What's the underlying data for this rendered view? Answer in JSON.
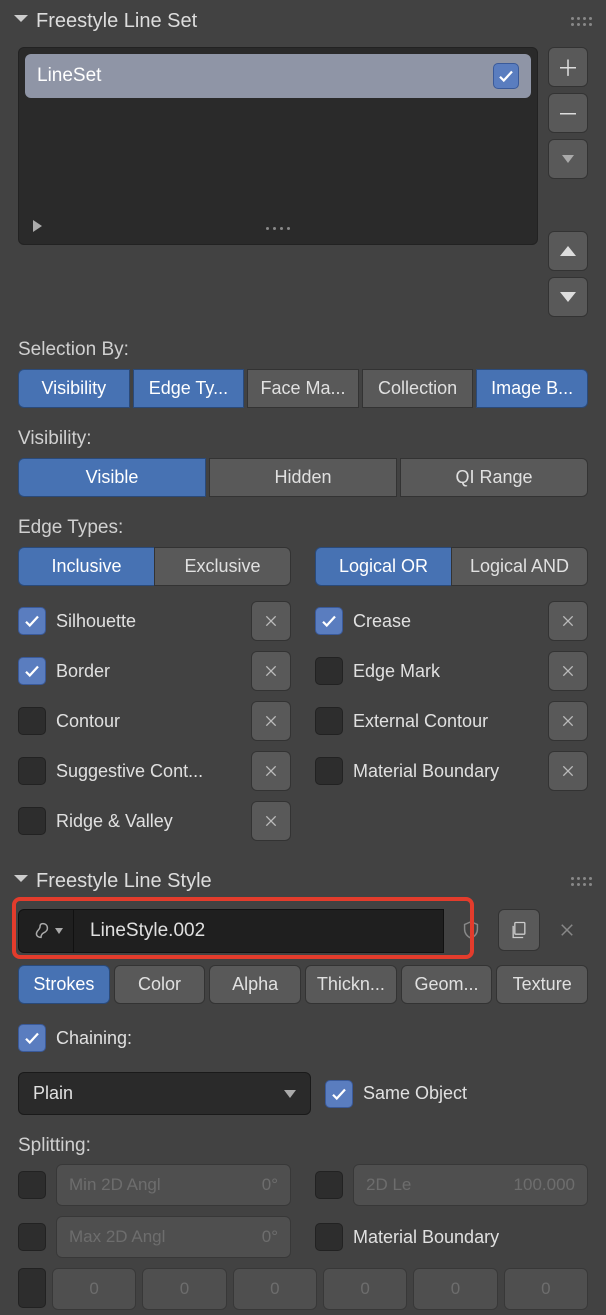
{
  "lineset_panel": {
    "title": "Freestyle Line Set",
    "items": [
      {
        "name": "LineSet",
        "enabled": true
      }
    ]
  },
  "selection_by": {
    "label": "Selection By:",
    "options": [
      {
        "label": "Visibility",
        "active": true
      },
      {
        "label": "Edge Ty...",
        "active": true
      },
      {
        "label": "Face Ma...",
        "active": false
      },
      {
        "label": "Collection",
        "active": false
      },
      {
        "label": "Image B...",
        "active": true
      }
    ]
  },
  "visibility": {
    "label": "Visibility:",
    "options": [
      {
        "label": "Visible",
        "active": true
      },
      {
        "label": "Hidden",
        "active": false
      },
      {
        "label": "QI Range",
        "active": false
      }
    ]
  },
  "edge_types": {
    "label": "Edge Types:",
    "inclusive": {
      "a": "Inclusive",
      "b": "Exclusive",
      "active": "a"
    },
    "logical": {
      "a": "Logical OR",
      "b": "Logical AND",
      "active": "a"
    },
    "checks": [
      {
        "left": {
          "label": "Silhouette",
          "on": true
        },
        "right": {
          "label": "Crease",
          "on": true
        }
      },
      {
        "left": {
          "label": "Border",
          "on": true
        },
        "right": {
          "label": "Edge Mark",
          "on": false
        }
      },
      {
        "left": {
          "label": "Contour",
          "on": false
        },
        "right": {
          "label": "External Contour",
          "on": false
        }
      },
      {
        "left": {
          "label": "Suggestive Cont...",
          "on": false
        },
        "right": {
          "label": "Material Boundary",
          "on": false
        }
      },
      {
        "left": {
          "label": "Ridge & Valley",
          "on": false
        },
        "right": null
      }
    ]
  },
  "linestyle_panel": {
    "title": "Freestyle Line Style",
    "name": "LineStyle.002",
    "tabs": [
      {
        "label": "Strokes",
        "active": true
      },
      {
        "label": "Color",
        "active": false
      },
      {
        "label": "Alpha",
        "active": false
      },
      {
        "label": "Thickn...",
        "active": false
      },
      {
        "label": "Geom...",
        "active": false
      },
      {
        "label": "Texture",
        "active": false
      }
    ],
    "chaining": {
      "label": "Chaining:",
      "on": true,
      "method": "Plain",
      "same_object_label": "Same Object",
      "same_object_on": true
    },
    "splitting": {
      "label": "Splitting:",
      "min_angle": {
        "label": "Min 2D Angl",
        "val": "0°",
        "on": false
      },
      "max_angle": {
        "label": "Max 2D Angl",
        "val": "0°",
        "on": false
      },
      "length_2d": {
        "label": "2D Le",
        "val": "100.000",
        "on": false
      },
      "mat_boundary": {
        "label": "Material Boundary",
        "on": false
      },
      "dashes": [
        0,
        0,
        0,
        0,
        0,
        0
      ]
    }
  }
}
